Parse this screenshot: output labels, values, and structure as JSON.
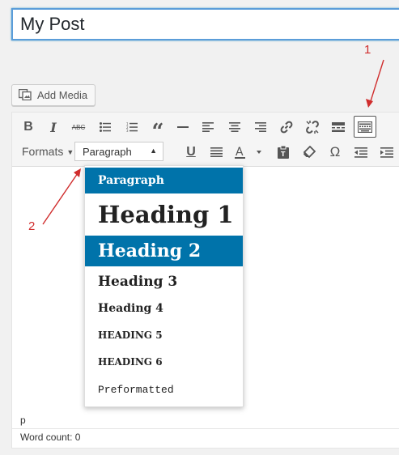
{
  "title": {
    "value": "My Post"
  },
  "add_media": {
    "label": "Add Media",
    "icon": "media-icon"
  },
  "toolbar": {
    "row1": [
      {
        "name": "bold-button",
        "icon": "bold-icon",
        "glyph": "B"
      },
      {
        "name": "italic-button",
        "icon": "italic-icon",
        "glyph": "I"
      },
      {
        "name": "strikethrough-button",
        "icon": "strikethrough-icon",
        "glyph": "ABC"
      },
      {
        "name": "bulleted-list-button",
        "icon": "bulleted-list-icon"
      },
      {
        "name": "numbered-list-button",
        "icon": "numbered-list-icon"
      },
      {
        "name": "blockquote-button",
        "icon": "blockquote-icon",
        "glyph": "“"
      },
      {
        "name": "horizontal-line-button",
        "icon": "horizontal-line-icon"
      },
      {
        "name": "align-left-button",
        "icon": "align-left-icon"
      },
      {
        "name": "align-center-button",
        "icon": "align-center-icon"
      },
      {
        "name": "align-right-button",
        "icon": "align-right-icon"
      },
      {
        "name": "insert-link-button",
        "icon": "link-icon"
      },
      {
        "name": "remove-link-button",
        "icon": "unlink-icon"
      },
      {
        "name": "read-more-button",
        "icon": "read-more-icon"
      },
      {
        "name": "toolbar-toggle-button",
        "icon": "keyboard-icon"
      }
    ],
    "formats_label": "Formats",
    "paragraph_value": "Paragraph",
    "row2": [
      {
        "name": "underline-button",
        "icon": "underline-icon",
        "glyph": "U"
      },
      {
        "name": "justify-button",
        "icon": "justify-icon"
      },
      {
        "name": "text-color-button",
        "icon": "text-color-icon",
        "glyph": "A"
      },
      {
        "name": "paste-text-button",
        "icon": "clipboard-icon"
      },
      {
        "name": "clear-formatting-button",
        "icon": "eraser-icon"
      },
      {
        "name": "special-character-button",
        "icon": "omega-icon",
        "glyph": "Ω"
      },
      {
        "name": "outdent-button",
        "icon": "outdent-icon"
      },
      {
        "name": "indent-button",
        "icon": "indent-icon"
      }
    ]
  },
  "dropdown": {
    "items": [
      {
        "label": "Paragraph",
        "selected": true
      },
      {
        "label": "Heading 1",
        "selected": false
      },
      {
        "label": "Heading 2",
        "selected": true
      },
      {
        "label": "Heading 3",
        "selected": false
      },
      {
        "label": "Heading 4",
        "selected": false
      },
      {
        "label": "HEADING 5",
        "selected": false
      },
      {
        "label": "HEADING 6",
        "selected": false
      },
      {
        "label": "Preformatted",
        "selected": false
      }
    ]
  },
  "status": {
    "path": "p",
    "word_count": "Word count: 0"
  },
  "annotations": {
    "one": "1",
    "two": "2"
  },
  "colors": {
    "accent": "#0073aa",
    "annotation": "#d02d2d",
    "focus": "#5b9dd9"
  }
}
